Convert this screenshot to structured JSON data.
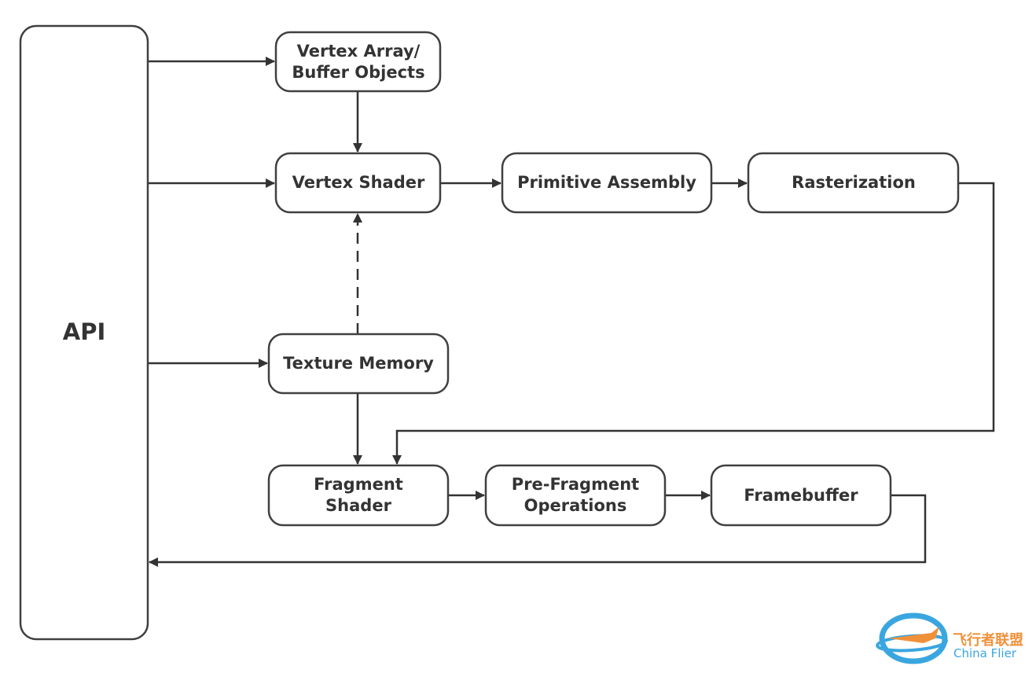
{
  "nodes": {
    "api": {
      "label": "API"
    },
    "vertex_array": {
      "line1": "Vertex Array/",
      "line2": "Buffer Objects"
    },
    "vertex_shader": {
      "label": "Vertex Shader"
    },
    "primitive_assembly": {
      "label": "Primitive Assembly"
    },
    "rasterization": {
      "label": "Rasterization"
    },
    "texture_memory": {
      "label": "Texture Memory"
    },
    "fragment_shader": {
      "line1": "Fragment",
      "line2": "Shader"
    },
    "pre_fragment": {
      "line1": "Pre-Fragment",
      "line2": "Operations"
    },
    "framebuffer": {
      "label": "Framebuffer"
    }
  },
  "watermark": {
    "text_cn": "飞行者联盟",
    "text_en": "China Flier",
    "colors": {
      "orange": "#f0913a",
      "blue": "#3aa6e0"
    }
  },
  "colors": {
    "stroke": "#404040",
    "text": "#333333"
  }
}
